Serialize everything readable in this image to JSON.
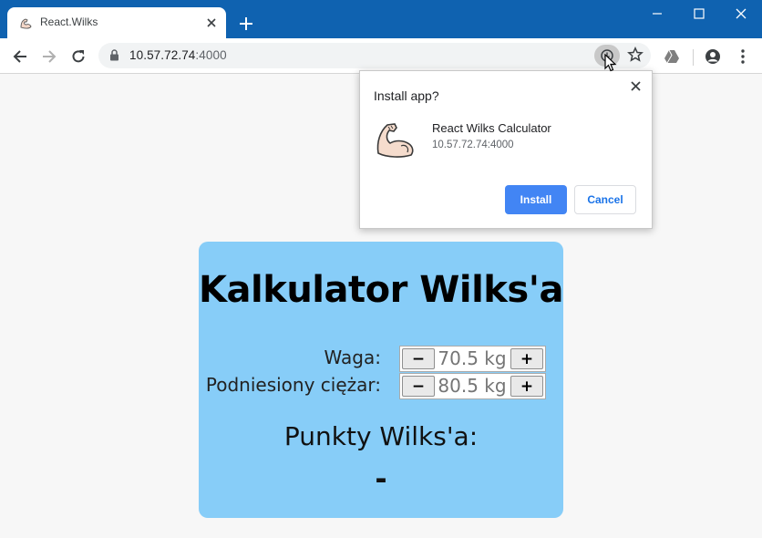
{
  "browser": {
    "tab_title": "React.Wilks",
    "url_host": "10.57.72.74",
    "url_port": ":4000"
  },
  "install_dialog": {
    "title": "Install app?",
    "app_name": "React Wilks Calculator",
    "app_origin": "10.57.72.74:4000",
    "install_label": "Install",
    "cancel_label": "Cancel"
  },
  "app": {
    "title": "Kalkulator Wilks'a",
    "weight": {
      "label": "Waga:",
      "value": "70.5 kg",
      "minus": "−",
      "plus": "+"
    },
    "lifted": {
      "label": "Podniesiony ciężar:",
      "value": "80.5 kg",
      "minus": "−",
      "plus": "+"
    },
    "result_label": "Punkty Wilks'a:",
    "result_value": "-"
  },
  "colors": {
    "titlebar": "#0f62b0",
    "card": "#87cdf8",
    "install_button": "#4285f4"
  },
  "icons": [
    "favicon-arm-icon",
    "close-icon",
    "plus-icon",
    "minimize-icon",
    "maximize-icon",
    "back-icon",
    "forward-icon",
    "reload-icon",
    "lock-icon",
    "install-app-icon",
    "star-icon",
    "drive-icon",
    "account-icon",
    "menu-icon",
    "cursor-icon",
    "flexed-arm-icon"
  ]
}
